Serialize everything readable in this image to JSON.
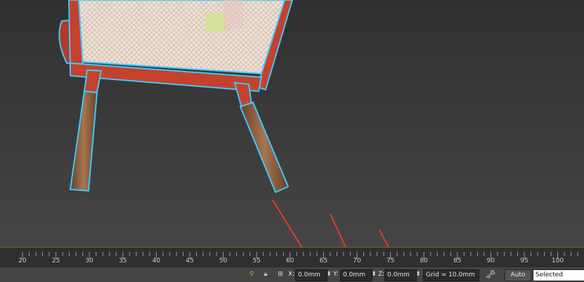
{
  "timeline": {
    "ticks": [
      "20",
      "25",
      "30",
      "35",
      "40",
      "45",
      "50",
      "55",
      "60",
      "65",
      "70",
      "75",
      "80",
      "85",
      "90",
      "95",
      "100"
    ]
  },
  "status": {
    "x_label": "X:",
    "x_value": "0.0mm",
    "y_label": "Y:",
    "y_value": "0.0mm",
    "z_label": "Z:",
    "z_value": "0.0mm",
    "grid_text": "Grid = 10.0mm",
    "auto_label": "Auto",
    "selected_label": "Selected"
  },
  "icons": {
    "pin": "pin-icon",
    "lock": "lock-icon",
    "transform": "absolute-mode-icon",
    "key": "key-icon",
    "spinner": "spinner-icon"
  },
  "colors": {
    "arrow": "#e53a2e",
    "chair_frame": "#c6412b",
    "wood": "#8a5a3a",
    "selection_outline": "#3fc8ff"
  }
}
